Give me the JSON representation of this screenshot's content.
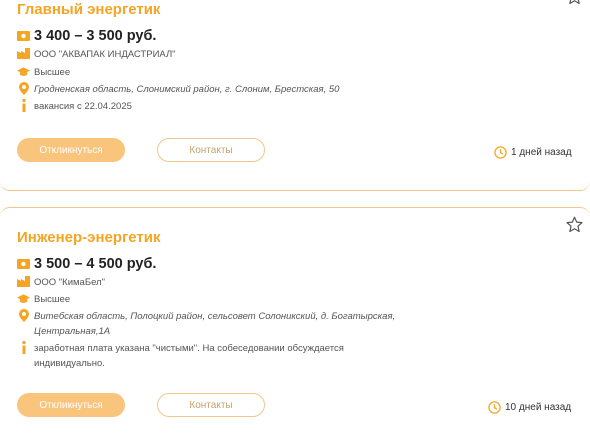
{
  "colors": {
    "accent": "#f5a524",
    "button_fill": "#f9c57d",
    "border": "#f0c889"
  },
  "vacancies": [
    {
      "title": "Главный энергетик",
      "salary": "3 400 – 3 500 руб.",
      "company": "ООО \"АКВАПАК ИНДАСТРИАЛ\"",
      "education": "Высшее",
      "address": "Гродненская область, Слонимский район, г. Слоним, Брестская, 50",
      "info": "вакансия с 22.04.2025",
      "respond_label": "Откликнуться",
      "contacts_label": "Контакты",
      "posted_ago": "1 дней назад"
    },
    {
      "title": "Инженер-энергетик",
      "salary": "3 500 – 4 500 руб.",
      "company": "ООО \"КимаБел\"",
      "education": "Высшее",
      "address_line1": "Витебская область, Полоцкий район, сельсовет Солоникский, д. Богатырская,",
      "address_line2": "Центральная,1А",
      "info_line1": "заработная плата указана \"чистыми\". На собеседовании обсуждается",
      "info_line2": "индивидуально.",
      "respond_label": "Откликнуться",
      "contacts_label": "Контакты",
      "posted_ago": "10 дней назад"
    }
  ],
  "icons": [
    "money-icon",
    "building-icon",
    "graduation-cap-icon",
    "location-pin-icon",
    "info-icon",
    "clock-icon",
    "star-icon"
  ]
}
